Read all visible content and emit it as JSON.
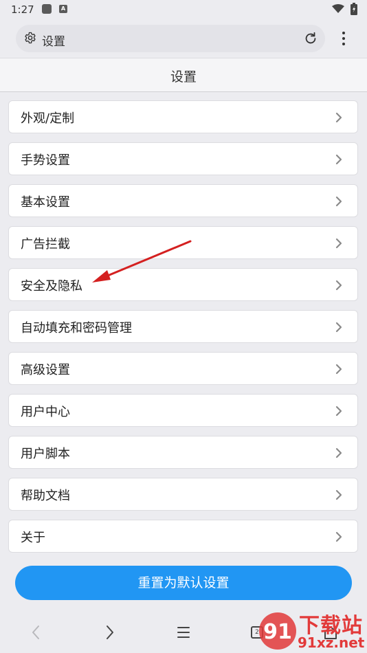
{
  "status_bar": {
    "time": "1:27",
    "a_icon": "A"
  },
  "url_bar": {
    "text": "设置"
  },
  "header": {
    "title": "设置"
  },
  "menu_items": [
    {
      "label": "外观/定制"
    },
    {
      "label": "手势设置"
    },
    {
      "label": "基本设置"
    },
    {
      "label": "广告拦截"
    },
    {
      "label": "安全及隐私"
    },
    {
      "label": "自动填充和密码管理"
    },
    {
      "label": "高级设置"
    },
    {
      "label": "用户中心"
    },
    {
      "label": "用户脚本"
    },
    {
      "label": "帮助文档"
    },
    {
      "label": "关于"
    }
  ],
  "reset_button": {
    "label": "重置为默认设置"
  },
  "nav": {
    "tab_count": "2"
  },
  "watermark": {
    "title": "下载站",
    "domain": "91xz.net",
    "logo": "91"
  },
  "colors": {
    "accent": "#2196f3",
    "arrow": "#d42020",
    "watermark": "#e23a3a"
  },
  "icons": [
    "gear-icon",
    "reload-icon",
    "more-menu-icon",
    "chevron-right-icon",
    "back-icon",
    "forward-icon",
    "menu-icon",
    "tabs-icon",
    "home-icon",
    "wifi-icon",
    "battery-icon"
  ]
}
